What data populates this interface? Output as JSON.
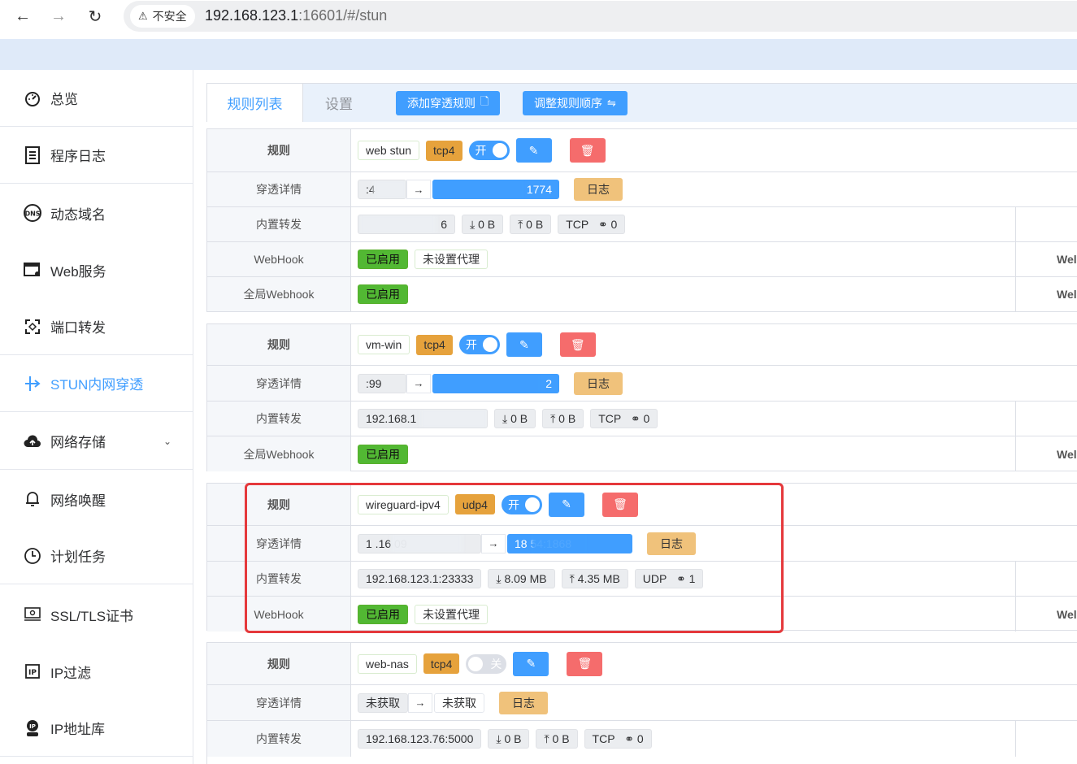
{
  "browser": {
    "back_icon": "←",
    "forward_icon": "→",
    "reload_icon": "↻",
    "security_label": "不安全",
    "url_host": "192.168.123.1",
    "url_rest": ":16601/#/stun"
  },
  "sidebar": {
    "items": [
      {
        "label": "总览",
        "icon": "dashboard-icon"
      },
      {
        "label": "程序日志",
        "icon": "log-icon"
      },
      {
        "label": "动态域名",
        "icon": "dns-icon"
      },
      {
        "label": "Web服务",
        "icon": "web-service-icon"
      },
      {
        "label": "端口转发",
        "icon": "port-forward-icon"
      },
      {
        "label": "STUN内网穿透",
        "icon": "stun-icon"
      },
      {
        "label": "网络存储",
        "icon": "cloud-storage-icon"
      },
      {
        "label": "网络唤醒",
        "icon": "bell-icon"
      },
      {
        "label": "计划任务",
        "icon": "clock-icon"
      },
      {
        "label": "SSL/TLS证书",
        "icon": "certificate-icon"
      },
      {
        "label": "IP过滤",
        "icon": "ip-filter-icon"
      },
      {
        "label": "IP地址库",
        "icon": "ip-database-icon"
      }
    ],
    "active": "STUN内网穿透"
  },
  "tabs": {
    "rules": "规则列表",
    "settings": "设置"
  },
  "toolbar": {
    "add_rule": "添加穿透规则",
    "reorder": "调整规则顺序"
  },
  "labels": {
    "rule": "规则",
    "detail": "穿透详情",
    "forward": "内置转发",
    "webhook": "WebHook",
    "global_webhook": "全局Webhook",
    "log": "日志",
    "enabled": "已启用",
    "no_proxy": "未设置代理",
    "on": "开",
    "off": "关",
    "right_cut": "Wel"
  },
  "rules": [
    {
      "name": "web stun",
      "proto": "tcp4",
      "switch": "开",
      "detail_local": ":4",
      "detail_public": "1774",
      "forward_addr": "6",
      "down": "0 B",
      "up": "0 B",
      "net": "TCP",
      "conns": "0",
      "webhook": "已启用",
      "proxy": "未设置代理",
      "global_webhook": "已启用"
    },
    {
      "name": "vm-win",
      "proto": "tcp4",
      "switch": "开",
      "detail_local": ":99",
      "detail_public": "2",
      "forward_addr": "192.168.1",
      "down": "0 B",
      "up": "0 B",
      "net": "TCP",
      "conns": "0",
      "global_webhook": "已启用"
    },
    {
      "name": "wireguard-ipv4",
      "proto": "udp4",
      "switch": "开",
      "detail_local": "1 .16  09",
      "detail_public": "18  54:1868",
      "forward_addr": "192.168.123.1:23333",
      "down": "8.09 MB",
      "up": "4.35 MB",
      "net": "UDP",
      "conns": "1",
      "webhook": "已启用",
      "proxy": "未设置代理"
    },
    {
      "name": "web-nas",
      "proto": "tcp4",
      "switch": "关",
      "detail_local": "未获取",
      "detail_public": "未获取",
      "forward_addr": "192.168.123.76:5000",
      "down": "0 B",
      "up": "0 B",
      "net": "TCP",
      "conns": "0"
    }
  ]
}
